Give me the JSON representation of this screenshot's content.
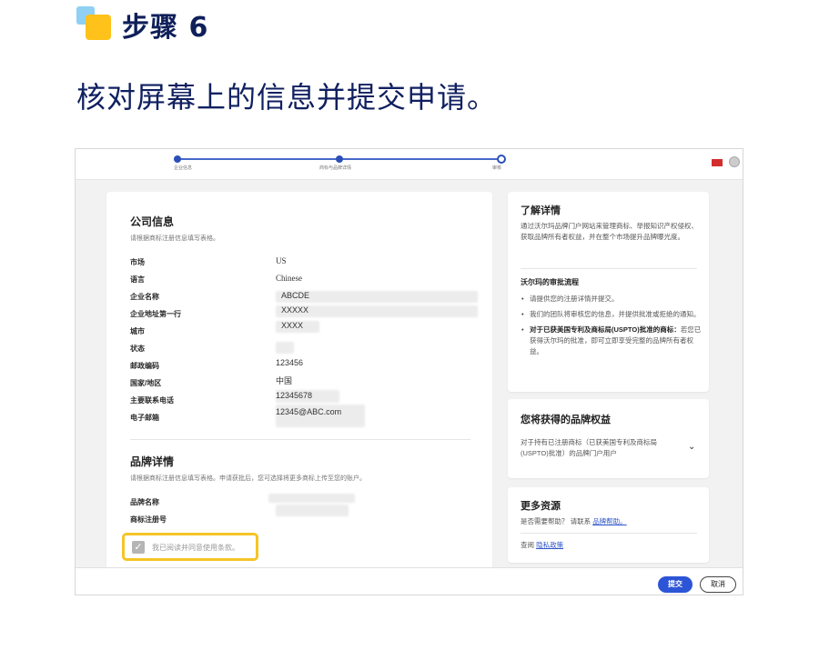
{
  "header": {
    "step_title": "步骤 6",
    "instruction": "核对屏幕上的信息并提交申请。"
  },
  "progress": {
    "steps": [
      "企业信息",
      "商标与品牌详情",
      "审核"
    ]
  },
  "company": {
    "title": "公司信息",
    "subtitle": "请根据商标注册信息填写表格。",
    "rows": [
      {
        "label": "市场",
        "value": "US"
      },
      {
        "label": "语言",
        "value": "Chinese"
      },
      {
        "label": "企业名称",
        "value": "ABCDE"
      },
      {
        "label": "企业地址第一行",
        "value": "XXXXX"
      },
      {
        "label": "城市",
        "value": "XXXX"
      },
      {
        "label": "状态",
        "value": ""
      },
      {
        "label": "邮政编码",
        "value": "123456"
      },
      {
        "label": "国家/地区",
        "value": "中国"
      },
      {
        "label": "主要联系电话",
        "value": "12345678"
      },
      {
        "label": "电子邮箱",
        "value": "12345@ABC.com"
      }
    ]
  },
  "brand": {
    "title": "品牌详情",
    "subtitle": "请根据商标注册信息填写表格。申请获批后，您可选择将更多商标上传至您的账户。",
    "rows": [
      {
        "label": "品牌名称",
        "value": ""
      },
      {
        "label": "商标注册号",
        "value": ""
      }
    ],
    "agree_label": "我已阅读并同意使用条款。"
  },
  "sidebar": {
    "about_title": "了解详情",
    "about_text": "通过沃尔玛品牌门户网站来管理商标、举报知识产权侵权、获取品牌所有者权益，并在整个市场提升品牌曝光度。",
    "process_title": "沃尔玛的审批流程",
    "bullets": [
      {
        "bold": "",
        "text": "请提供您的注册详情并提交。"
      },
      {
        "bold": "",
        "text": "我们的团队将审核您的信息，并提供批准或拒绝的通知。"
      },
      {
        "bold": "对于已获美国专利及商标局(USPTO)批准的商标：",
        "text": "若您已获得沃尔玛的批准，即可立即享受完整的品牌所有者权益。"
      }
    ],
    "benefits_title": "您将获得的品牌权益",
    "benefits_text": "对于持有已注册商标（已获美国专利及商标局(USPTO)批准）的品牌门户用户",
    "resources_title": "更多资源",
    "help_prefix": "是否需要帮助？ 请联系",
    "help_link": "品牌帮助。",
    "privacy_prefix": "查阅",
    "privacy_link": "隐私政策"
  },
  "footer": {
    "submit_label": "提交",
    "cancel_label": "取消"
  },
  "colors": {
    "accent": "#2c54d6",
    "highlight": "#f5c427",
    "heading": "#0f1f59"
  }
}
